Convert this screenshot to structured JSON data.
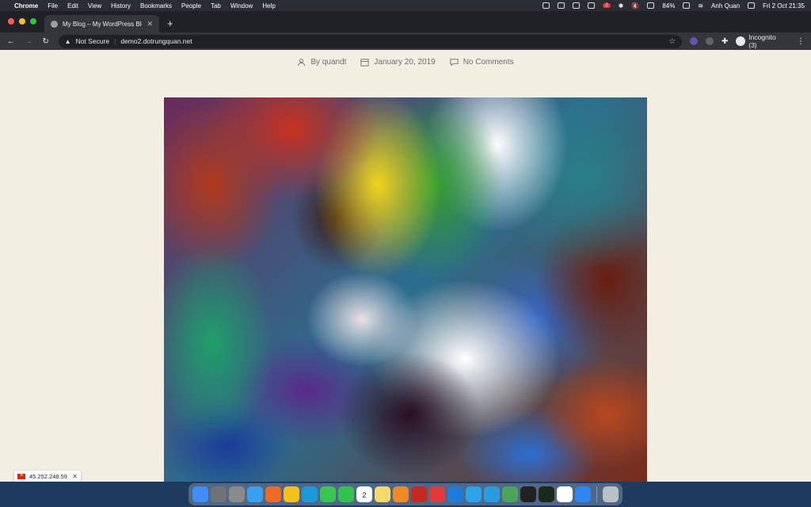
{
  "menubar": {
    "app_name": "Chrome",
    "items": [
      "File",
      "Edit",
      "View",
      "History",
      "Bookmarks",
      "People",
      "Tab",
      "Window",
      "Help"
    ],
    "user": "Anh Quan",
    "battery": "84%",
    "datetime": "Fri 2 Oct  21:35",
    "notification_badge": "2"
  },
  "browser": {
    "tab_title": "My Blog – My WordPress Blog",
    "security_label": "Not Secure",
    "url": "demo2.dotrungquan.net",
    "incognito_label": "Incognito (3)"
  },
  "post_meta": {
    "author": "By quandt",
    "date": "January 20, 2019",
    "comments": "No Comments"
  },
  "ip_popup": {
    "ip": "45.252.248.59"
  },
  "dock": {
    "calendar_day": "2",
    "icons": [
      "finder-icon",
      "system-preferences-icon",
      "screenshot-icon",
      "safari-icon",
      "firefox-icon",
      "chrome-icon",
      "edge-icon",
      "messages-icon",
      "facetime-icon",
      "calendar-icon",
      "notes-icon",
      "sublime-icon",
      "filezilla-icon",
      "creative-cloud-icon",
      "onedrive-sync-icon",
      "skype-icon",
      "telegram-icon",
      "sourcetree-icon",
      "terminal-icon",
      "iterm-icon",
      "zalo-icon",
      "app-store-icon",
      "trash-icon"
    ]
  },
  "colors": {
    "page_bg": "#f3eee2",
    "chrome_dark": "#202124",
    "meta_text": "#6d6d6d"
  }
}
